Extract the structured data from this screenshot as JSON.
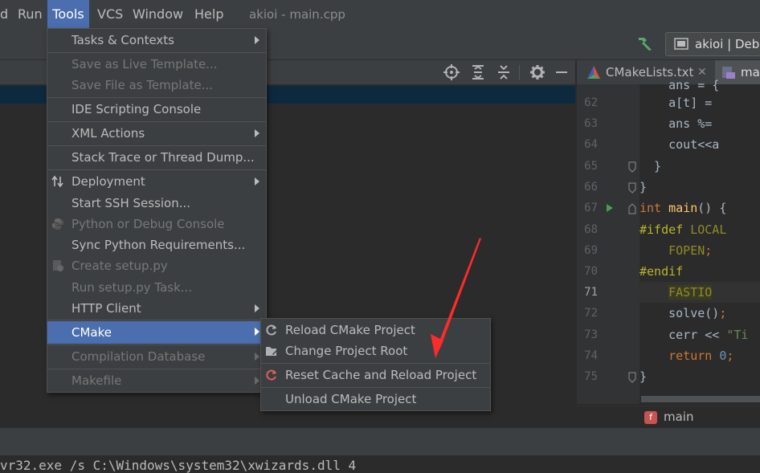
{
  "menubar": {
    "items": [
      {
        "label": "d"
      },
      {
        "label": "Run"
      },
      {
        "label": "Tools"
      },
      {
        "label": "VCS"
      },
      {
        "label": "Window"
      },
      {
        "label": "Help"
      }
    ],
    "window_title": "akioi - main.cpp"
  },
  "toolbar": {
    "hammer_icon": "build-hammer-icon",
    "run_config_label": "akioi | Debu"
  },
  "tools_menu": {
    "items": [
      {
        "label": "Tasks & Contexts",
        "submenu": true,
        "enabled": true
      },
      {
        "label": "Save as Live Template...",
        "enabled": false
      },
      {
        "label": "Save File as Template...",
        "enabled": false
      },
      {
        "label": "IDE Scripting Console",
        "enabled": true
      },
      {
        "label": "XML Actions",
        "submenu": true,
        "enabled": true
      },
      {
        "label": "Stack Trace or Thread Dump...",
        "enabled": true
      },
      {
        "label": "Deployment",
        "submenu": true,
        "enabled": true,
        "icon": "deployment-arrows-icon"
      },
      {
        "label": "Start SSH Session...",
        "enabled": true
      },
      {
        "label": "Python or Debug Console",
        "enabled": false,
        "icon": "python-icon"
      },
      {
        "label": "Sync Python Requirements...",
        "enabled": true
      },
      {
        "label": "Create setup.py",
        "enabled": false,
        "icon": "setup-py-icon"
      },
      {
        "label": "Run setup.py Task...",
        "enabled": false
      },
      {
        "label": "HTTP Client",
        "submenu": true,
        "enabled": true
      },
      {
        "label": "CMake",
        "submenu": true,
        "enabled": true,
        "selected": true
      },
      {
        "label": "Compilation Database",
        "submenu": true,
        "enabled": false
      },
      {
        "label": "Makefile",
        "submenu": true,
        "enabled": false
      }
    ]
  },
  "cmake_submenu": {
    "items": [
      {
        "label": "Reload CMake Project",
        "icon": "reload-icon"
      },
      {
        "label": "Change Project Root",
        "icon": "change-root-icon"
      },
      {
        "label": "Reset Cache and Reload Project",
        "icon": "reset-reload-icon"
      },
      {
        "label": "Unload CMake Project"
      }
    ]
  },
  "editor": {
    "tabs": [
      {
        "label": "CMakeLists.txt",
        "icon": "cmake-triangle-icon"
      },
      {
        "label": "mai",
        "icon": "cpp-file-icon"
      }
    ],
    "lines": [
      {
        "num": "62",
        "code": "    a[t] ="
      },
      {
        "num": "63",
        "code": "    ans %="
      },
      {
        "num": "64",
        "code": "    cout<<a"
      },
      {
        "num": "65",
        "code": "  }"
      },
      {
        "num": "66",
        "code": "}"
      },
      {
        "num": "67",
        "code": "int main() {"
      },
      {
        "num": "68",
        "code": "#ifdef LOCAL"
      },
      {
        "num": "69",
        "code": "  FOPEN;"
      },
      {
        "num": "70",
        "code": "#endif"
      },
      {
        "num": "71",
        "code": "  FASTIO"
      },
      {
        "num": "72",
        "code": "  solve();"
      },
      {
        "num": "73",
        "code": "  cerr << \"Ti"
      },
      {
        "num": "74",
        "code": "  return 0;"
      },
      {
        "num": "75",
        "code": "}"
      }
    ],
    "breadcrumb": "main",
    "breadcrumb_icon": "function-f-icon"
  },
  "terminal": {
    "text": "vr32.exe /s C:\\Windows\\system32\\xwizards.dll 4"
  },
  "colors": {
    "accent": "#4b6eaf",
    "keyword": "#cc7832",
    "macro": "#908b25",
    "number": "#6897bb",
    "string": "#6a8759",
    "annotation_arrow": "#ff2a2a"
  }
}
